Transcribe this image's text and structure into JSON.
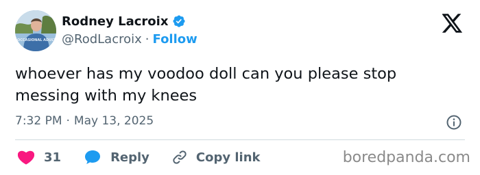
{
  "author": {
    "display_name": "Rodney Lacroix",
    "handle": "@RodLacroix",
    "separator": "·",
    "follow_label": "Follow",
    "avatar_shirt_text": "OCCASIONAL ADULT"
  },
  "tweet": {
    "text": "whoever has my voodoo doll can you please stop messing with my knees",
    "time": "7:32 PM",
    "separator": "·",
    "date": "May 13, 2025"
  },
  "actions": {
    "like_count": "31",
    "reply_label": "Reply",
    "copy_link_label": "Copy link"
  },
  "watermark": "boredpanda.com",
  "icons": {
    "verified": "verified-badge-icon",
    "x_logo": "x-logo-icon",
    "info": "info-icon",
    "like": "heart-icon",
    "reply": "speech-bubble-icon",
    "copy_link": "link-icon"
  },
  "colors": {
    "accent": "#1d9bf0",
    "like": "#f91880",
    "text_primary": "#0f1419",
    "text_secondary": "#536471",
    "divider": "#cfd9de"
  }
}
